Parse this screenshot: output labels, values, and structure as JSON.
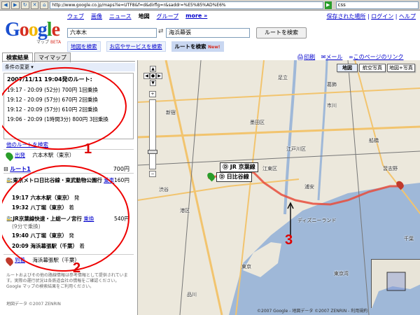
{
  "browser": {
    "url": "http://www.google.co.jp/maps?ie=UTF8&f=d&dirflg=r&saddr=%E5%85%AD%E6%",
    "search_value": "css"
  },
  "header": {
    "logo_letters": [
      "G",
      "o",
      "o",
      "g",
      "l",
      "e"
    ],
    "logo_sub": "マップ",
    "beta": "BETA",
    "nav": [
      "ウェブ",
      "画像",
      "ニュース",
      "地図",
      "グループ",
      "more »"
    ],
    "top_links": [
      "保存された場所",
      "ログイン",
      "ヘルプ"
    ],
    "from_value": "六本木",
    "to_value": "海浜幕張",
    "route_button": "ルートを検索",
    "subtabs": [
      "地図を検索",
      "お店やサービスを検索",
      "ルートを検索"
    ],
    "new_badge": "New!"
  },
  "left": {
    "tabs": [
      "検索結果",
      "マイマップ"
    ],
    "cond_bar": "条件の変更",
    "results_heading": "2007/11/11 19:04発のルート:",
    "results": [
      "19:17 - 20:09 (52分) 700円 1回乗換",
      "19:12 - 20:09 (57分) 670円 2回乗換",
      "19:12 - 20:09 (57分) 610円 2回乗換",
      "19:06 - 20:09 (1時間3分) 800円 3回乗換"
    ],
    "other_routes": "他のルートを検索",
    "origin_label": "出発",
    "origin_station": "六本木駅（東京）",
    "route_label": "ルート1",
    "route_price": "700円",
    "step1_line": "東京メトロ日比谷線・東武動物公園行",
    "step1_link": "乗車",
    "step1_price": "160円",
    "step2_time": "19:17 六本木駅（東京）",
    "step2_suffix": "発",
    "step3_time": "19:32 八丁堀（東京）",
    "step3_suffix": "着",
    "step4_line": "JR京葉線快速・上総一ノ宮行",
    "step4_link": "乗換",
    "step4_price": "540円",
    "step4_wait": "(9分で乗換)",
    "step5_time": "19:40 八丁堀（東京）",
    "step5_suffix": "発",
    "step6_time": "20:09 海浜幕張駅（千葉）",
    "step6_suffix": "着",
    "dest_label": "到着",
    "dest_station": "海浜幕張駅（千葉）",
    "disclaimer": "ルートおよびその他の路線情報は参考情報として提供されています。実際の運行状況は各鉄道会社の情報をご確認ください。Google マップの検索結果をご利用ください。",
    "copyright": "地図データ ©2007 ZENRIN"
  },
  "map": {
    "tools": [
      "印刷",
      "メール",
      "このページのリンク"
    ],
    "types": [
      "地図",
      "航空写真",
      "地図+写真"
    ],
    "active_type": "地図",
    "station_jr": "JR 京葉線",
    "station_hibiya": "日比谷線",
    "labels": [
      "東京湾",
      "ディズニーランド",
      "東京",
      "品川",
      "新宿",
      "浦安",
      "江戸川区",
      "墨田区",
      "市川",
      "船橋",
      "習志野",
      "千葉",
      "江東区",
      "港区",
      "渋谷",
      "足立",
      "葛飾"
    ],
    "copyright": "©2007 Google - 地図データ ©2007 ZENRIN - 利用規約"
  },
  "annotations": [
    "1",
    "2",
    "3"
  ]
}
